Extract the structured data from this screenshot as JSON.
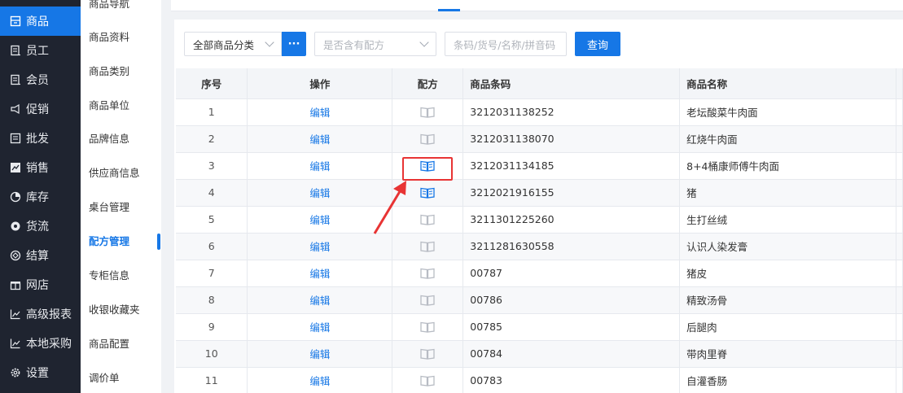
{
  "nav": {
    "items": [
      {
        "label": "商品",
        "icon": "goods-icon"
      },
      {
        "label": "员工",
        "icon": "staff-icon"
      },
      {
        "label": "会员",
        "icon": "member-icon"
      },
      {
        "label": "促销",
        "icon": "promotion-icon"
      },
      {
        "label": "批发",
        "icon": "wholesale-icon"
      },
      {
        "label": "销售",
        "icon": "sales-chart-icon"
      },
      {
        "label": "库存",
        "icon": "inventory-pie-icon"
      },
      {
        "label": "货流",
        "icon": "logistics-icon"
      },
      {
        "label": "结算",
        "icon": "settlement-icon"
      },
      {
        "label": "网店",
        "icon": "shop-gift-icon"
      },
      {
        "label": "高级报表",
        "icon": "report-chart-icon"
      },
      {
        "label": "本地采购",
        "icon": "purchase-chart-icon"
      },
      {
        "label": "设置",
        "icon": "settings-gear-icon"
      }
    ],
    "active_index": 0,
    "accent_color": "#1677e6",
    "bg_color": "#1f2430"
  },
  "subnav": {
    "items": [
      "商品导航",
      "商品资料",
      "商品类别",
      "商品单位",
      "品牌信息",
      "供应商信息",
      "桌台管理",
      "配方管理",
      "专柜信息",
      "收银收藏夹",
      "商品配置",
      "调价单"
    ],
    "active_index": 7
  },
  "filters": {
    "category_value": "全部商品分类",
    "more_button": "···",
    "recipe_placeholder": "是否含有配方",
    "search_placeholder": "条码/货号/名称/拼音码",
    "query_button": "查询"
  },
  "table": {
    "headers": {
      "index": "序号",
      "operation": "操作",
      "recipe": "配方",
      "barcode": "商品条码",
      "name": "商品名称"
    },
    "rows": [
      {
        "index": "1",
        "op": "编辑",
        "recipe_active": false,
        "barcode": "3212031138252",
        "name": "老坛酸菜牛肉面"
      },
      {
        "index": "2",
        "op": "编辑",
        "recipe_active": false,
        "barcode": "3212031138070",
        "name": "红烧牛肉面"
      },
      {
        "index": "3",
        "op": "编辑",
        "recipe_active": true,
        "barcode": "3212031134185",
        "name": "8+4桶康师傅牛肉面"
      },
      {
        "index": "4",
        "op": "编辑",
        "recipe_active": true,
        "barcode": "3212021916155",
        "name": "猪"
      },
      {
        "index": "5",
        "op": "编辑",
        "recipe_active": false,
        "barcode": "3211301225260",
        "name": "生打丝绒"
      },
      {
        "index": "6",
        "op": "编辑",
        "recipe_active": false,
        "barcode": "3211281630558",
        "name": "认识人染发膏"
      },
      {
        "index": "7",
        "op": "编辑",
        "recipe_active": false,
        "barcode": "00787",
        "name": "猪皮"
      },
      {
        "index": "8",
        "op": "编辑",
        "recipe_active": false,
        "barcode": "00786",
        "name": "精致汤骨"
      },
      {
        "index": "9",
        "op": "编辑",
        "recipe_active": false,
        "barcode": "00785",
        "name": "后腿肉"
      },
      {
        "index": "10",
        "op": "编辑",
        "recipe_active": false,
        "barcode": "00784",
        "name": "带肉里脊"
      },
      {
        "index": "11",
        "op": "编辑",
        "recipe_active": false,
        "barcode": "00783",
        "name": "自灌香肠"
      }
    ]
  },
  "annotation": {
    "highlight_color": "#e83434"
  }
}
